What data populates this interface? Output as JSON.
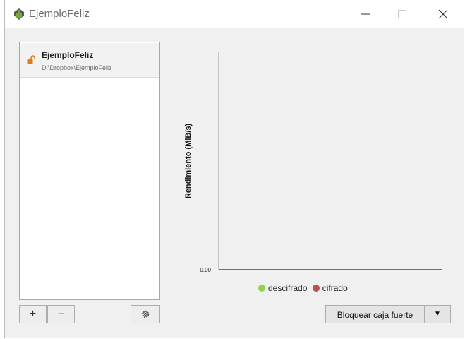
{
  "window": {
    "title": "EjemploFeliz"
  },
  "vaults": [
    {
      "name": "EjemploFeliz",
      "path": "D:\\Dropbox\\EjemploFeliz",
      "status": "unlocked"
    }
  ],
  "toolbar": {
    "add_label": "+",
    "remove_label": "−",
    "settings_icon": "gear-icon"
  },
  "chart_data": {
    "type": "line",
    "title": "",
    "xlabel": "",
    "ylabel": "Rendimiento (MiB/s)",
    "y_ticks": [
      "0.00"
    ],
    "ylim": [
      0,
      1
    ],
    "legend_position": "bottom",
    "series": [
      {
        "name": "descifrado",
        "color": "#92d050",
        "values": [
          0,
          0
        ]
      },
      {
        "name": "cifrado",
        "color": "#c0504d",
        "values": [
          0,
          0
        ]
      }
    ]
  },
  "actions": {
    "lock_vault_label": "Bloquear caja fuerte",
    "dropdown_arrow": "▼"
  },
  "colors": {
    "unlocked_accent": "#e07c1a"
  }
}
